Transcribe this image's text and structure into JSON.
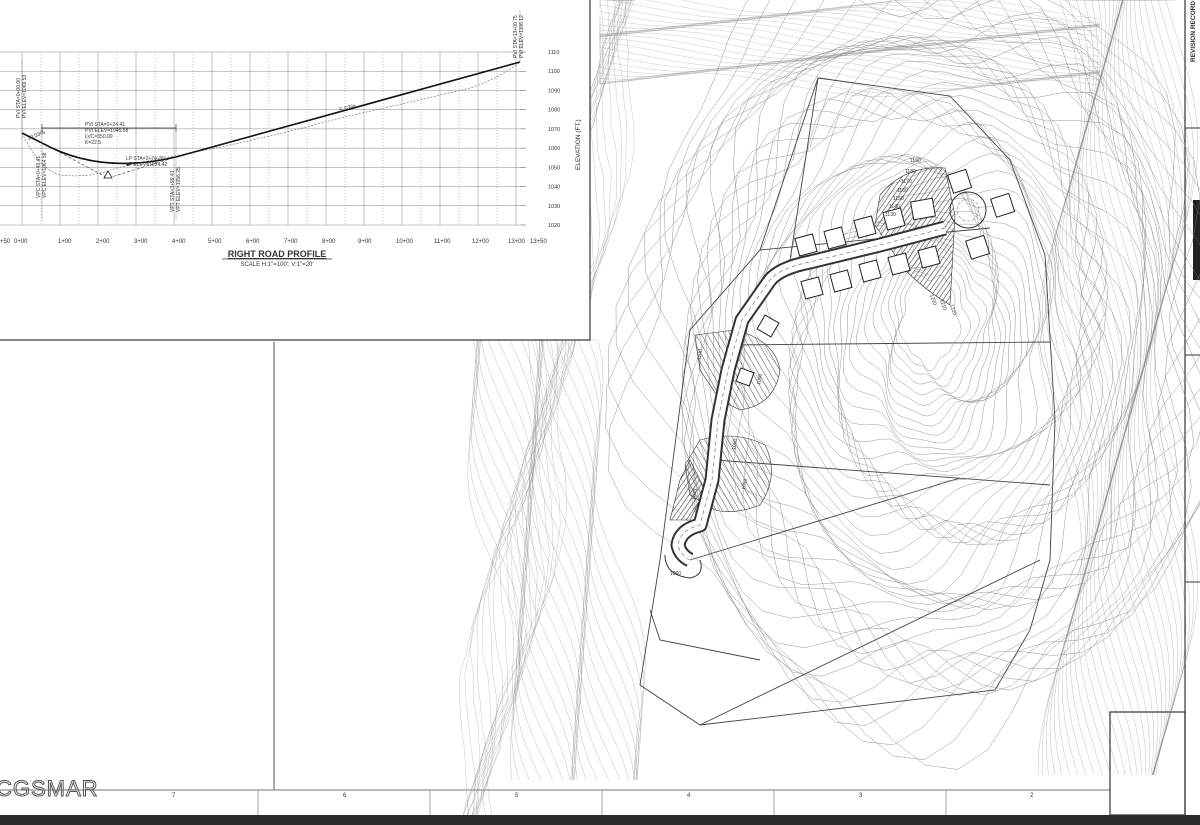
{
  "profile": {
    "title": "RIGHT ROAD PROFILE",
    "scale": "SCALE H:1\"=100'; V:1\"=20'",
    "elevation_axis_label": "ELEVATION (FT.)",
    "elevations": [
      "1110",
      "1100",
      "1090",
      "1080",
      "1070",
      "1060",
      "1050",
      "1040",
      "1030",
      "1020"
    ],
    "stations": [
      "+50",
      "0+00",
      "1+00",
      "2+00",
      "3+00",
      "4+00",
      "5+00",
      "6+00",
      "7+00",
      "8+00",
      "9+00",
      "10+00",
      "11+00",
      "12+00",
      "13+00",
      "13+50"
    ],
    "grade_label": "5.53%",
    "grade_left": "10.03%",
    "pvi1": [
      "PVI STA=2+24.41",
      "PVI ELEV=1046.58",
      "LVC=350.00",
      "K=22.5"
    ],
    "lp": [
      "LP STA=2+74.76",
      "LP ELEV=1054.42"
    ],
    "pvi_end": [
      "PVI STA=13+00.75",
      "PVI ELEV=1106.12"
    ],
    "pvi_start": [
      "PVI STA=0+00.00",
      "PVI ELEV=1069.53"
    ],
    "vpc": [
      "VPC STA=0+49.41",
      "VPC ELEV=1064.58"
    ],
    "vpt": [
      "VPT STA=3+99.41",
      "VPT ELEV=1056.25"
    ]
  },
  "sidebar": {
    "revision_label": "REVISION RECORD"
  },
  "grid_refs": [
    "7",
    "6",
    "5",
    "4",
    "3",
    "2"
  ],
  "contour_labels": [
    "1190",
    "1180",
    "1170",
    "1160",
    "1150",
    "1140",
    "1130",
    "1120",
    "1110",
    "1100",
    "1090",
    "1080",
    "1070",
    "1060",
    "1050",
    "1200",
    "1210",
    "1220"
  ],
  "watermark": "CGSMAR"
}
